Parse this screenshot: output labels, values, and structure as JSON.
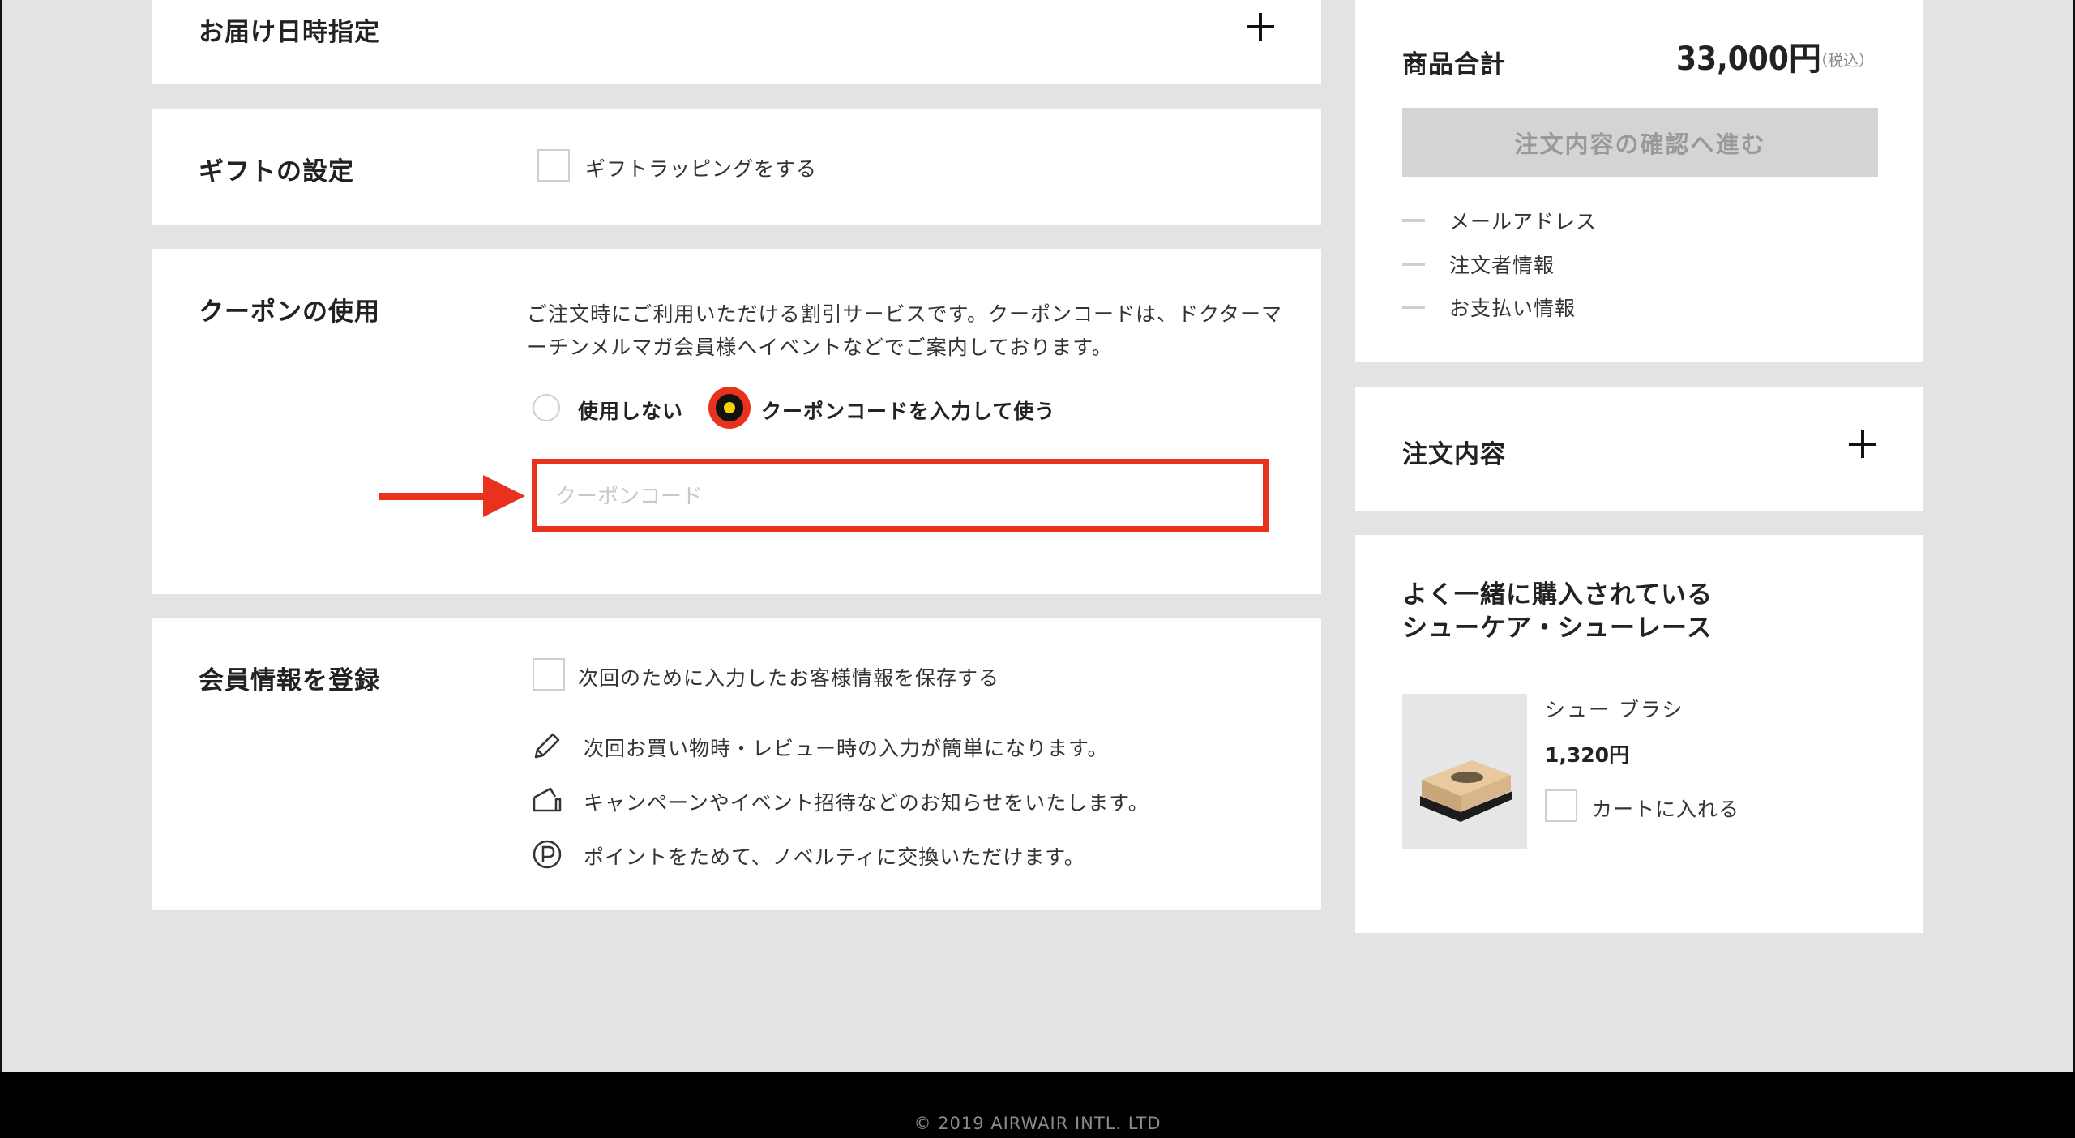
{
  "delivery": {
    "title": "お届け日時指定"
  },
  "gift": {
    "title": "ギフトの設定",
    "checkbox_label": "ギフトラッピングをする"
  },
  "coupon": {
    "title": "クーポンの使用",
    "description": "ご注文時にご利用いただける割引サービスです。クーポンコードは、ドクターマーチンメルマガ会員様へイベントなどでご案内しております。",
    "options": [
      "使用しない",
      "クーポンコードを入力して使う"
    ],
    "selected_option": "クーポンコードを入力して使う",
    "input_placeholder": "クーポンコード",
    "input_value": "",
    "highlight_color": "#e8321e"
  },
  "member": {
    "title": "会員情報を登録",
    "checkbox_label": "次回のために入力したお客様情報を保存する",
    "benefits": [
      {
        "icon": "pencil-icon",
        "text": "次回お買い物時・レビュー時の入力が簡単になります。"
      },
      {
        "icon": "ticket-icon",
        "text": "キャンペーンやイベント招待などのお知らせをいたします。"
      },
      {
        "icon": "point-p-icon",
        "text": "ポイントをためて、ノベルティに交換いただけます。"
      }
    ]
  },
  "summary": {
    "total_label": "商品合計",
    "total_value": "33,000円",
    "tax_note": "（税込）",
    "confirm_button": "注文内容の確認へ進む",
    "steps": [
      "メールアドレス",
      "注文者情報",
      "お支払い情報"
    ]
  },
  "order_contents": {
    "title": "注文内容"
  },
  "recommend": {
    "title_line1": "よく一緒に購入されている",
    "title_line2": "シューケア・シューレース",
    "product": {
      "name": "シュー ブラシ",
      "price": "1,320円",
      "cart_label": "カートに入れる"
    }
  },
  "footer": {
    "copyright": "© 2019 AIRWAIR INTL. LTD"
  }
}
